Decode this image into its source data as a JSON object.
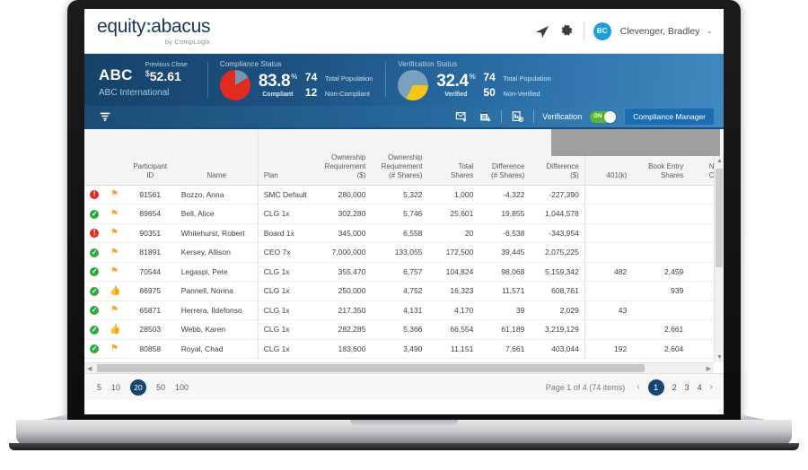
{
  "brand": {
    "logo_part1": "equity",
    "logo_sep": ":",
    "logo_part2": "abacus",
    "logo_tagline": "by CompLogix"
  },
  "topbar": {
    "send_icon": "paper-plane-icon",
    "settings_icon": "gear-icon",
    "avatar_initials": "BC",
    "user_name": "Clevenger, Bradley",
    "caret": "⌄"
  },
  "ticker": {
    "symbol": "ABC",
    "company": "ABC International",
    "prev_close_label": "Previous Close",
    "currency": "$",
    "prev_close_value": "52.61"
  },
  "compliance": {
    "title": "Compliance Status",
    "percent": "83.8",
    "percent_sup": "%",
    "percent_label": "Compliant",
    "total_population_value": "74",
    "total_population_label": "Total Population",
    "noncompliant_value": "12",
    "noncompliant_label": "Non-Compliant",
    "pie_primary_color": "#e02b20",
    "pie_secondary_color": "#7397b5"
  },
  "verification": {
    "title": "Verification Status",
    "percent": "32.4",
    "percent_sup": "%",
    "percent_label": "Verified",
    "total_population_value": "74",
    "total_population_label": "Total Population",
    "nonverified_value": "50",
    "nonverified_label": "Non-Verified",
    "pie_primary_color": "#f5c518",
    "pie_secondary_color": "#7ba0be"
  },
  "toolbar": {
    "filter_icon": "filter-funnel-icon",
    "mail_icon": "mail-add-icon",
    "export_icon": "excel-export-icon",
    "report_icon": "report-settings-icon",
    "verification_label": "Verification",
    "toggle_state": "ON",
    "compliance_manager_label": "Compliance Manager"
  },
  "grid": {
    "group_header": "",
    "columns": [
      {
        "label": "",
        "key": "status"
      },
      {
        "label": "",
        "key": "flag"
      },
      {
        "label": "Participant ID",
        "lines": [
          "Participant",
          "ID"
        ]
      },
      {
        "label": "Name",
        "lines": [
          "Name"
        ]
      },
      {
        "label": "Plan",
        "lines": [
          "Plan"
        ]
      },
      {
        "label": "Ownership Requirement ($)",
        "lines": [
          "Ownership",
          "Requirement",
          "($)"
        ]
      },
      {
        "label": "Ownership Requirement (# Shares)",
        "lines": [
          "Ownership",
          "Requirement",
          "(# Shares)"
        ]
      },
      {
        "label": "Total Shares",
        "lines": [
          "Total",
          "Shares"
        ]
      },
      {
        "label": "Difference (# Shares)",
        "lines": [
          "Difference",
          "(# Shares)"
        ]
      },
      {
        "label": "Difference ($)",
        "lines": [
          "Difference",
          "($)"
        ]
      },
      {
        "label": "401(k)",
        "lines": [
          "401(k)"
        ]
      },
      {
        "label": "Book Entry Shares",
        "lines": [
          "Book Entry",
          "Shares"
        ]
      },
      {
        "label": "No Co",
        "lines": [
          "No",
          "Co"
        ]
      }
    ],
    "rows": [
      {
        "status": "alert",
        "mark": "flag",
        "id": "91561",
        "name": "Bozzo, Anna",
        "plan": "SMC Default",
        "own_req_dollars": "280,000",
        "own_req_shares": "5,322",
        "total_shares": "1,000",
        "diff_shares": "-4,322",
        "diff_dollars": "-227,390",
        "k401": "",
        "book_entry": "",
        "no_co": ""
      },
      {
        "status": "ok",
        "mark": "flag",
        "id": "89654",
        "name": "Bell, Alice",
        "plan": "CLG 1x",
        "own_req_dollars": "302,280",
        "own_req_shares": "5,746",
        "total_shares": "25,601",
        "diff_shares": "19,855",
        "diff_dollars": "1,044,578",
        "k401": "",
        "book_entry": "",
        "no_co": ""
      },
      {
        "status": "alert",
        "mark": "flag",
        "id": "90351",
        "name": "Whitehurst, Robert",
        "plan": "Board 1x",
        "own_req_dollars": "345,000",
        "own_req_shares": "6,558",
        "total_shares": "20",
        "diff_shares": "-6,538",
        "diff_dollars": "-343,954",
        "k401": "",
        "book_entry": "",
        "no_co": ""
      },
      {
        "status": "ok",
        "mark": "flag",
        "id": "81891",
        "name": "Kersey, Allison",
        "plan": "CEO 7x",
        "own_req_dollars": "7,000,000",
        "own_req_shares": "133,055",
        "total_shares": "172,500",
        "diff_shares": "39,445",
        "diff_dollars": "2,075,225",
        "k401": "",
        "book_entry": "",
        "no_co": ""
      },
      {
        "status": "ok",
        "mark": "flag",
        "id": "70544",
        "name": "Legaspi, Pete",
        "plan": "CLG 1x",
        "own_req_dollars": "355,470",
        "own_req_shares": "6,757",
        "total_shares": "104,824",
        "diff_shares": "98,068",
        "diff_dollars": "5,159,342",
        "k401": "482",
        "book_entry": "2,459",
        "no_co": ""
      },
      {
        "status": "ok",
        "mark": "thumb",
        "id": "86975",
        "name": "Pannell, Norina",
        "plan": "CLG 1x",
        "own_req_dollars": "250,000",
        "own_req_shares": "4,752",
        "total_shares": "16,323",
        "diff_shares": "11,571",
        "diff_dollars": "608,761",
        "k401": "",
        "book_entry": "939",
        "no_co": ""
      },
      {
        "status": "ok",
        "mark": "flag",
        "id": "65871",
        "name": "Herrera, Ildefonso",
        "plan": "CLG 1x",
        "own_req_dollars": "217,350",
        "own_req_shares": "4,131",
        "total_shares": "4,170",
        "diff_shares": "39",
        "diff_dollars": "2,029",
        "k401": "43",
        "book_entry": "",
        "no_co": ""
      },
      {
        "status": "ok",
        "mark": "thumb",
        "id": "28503",
        "name": "Webb, Karen",
        "plan": "CLG 1x",
        "own_req_dollars": "282,285",
        "own_req_shares": "5,366",
        "total_shares": "66,554",
        "diff_shares": "61,189",
        "diff_dollars": "3,219,129",
        "k401": "",
        "book_entry": "2,661",
        "no_co": ""
      },
      {
        "status": "ok",
        "mark": "flag",
        "id": "80858",
        "name": "Royal, Chad",
        "plan": "CLG 1x",
        "own_req_dollars": "183,600",
        "own_req_shares": "3,490",
        "total_shares": "11,151",
        "diff_shares": "7,661",
        "diff_dollars": "403,044",
        "k401": "192",
        "book_entry": "2,604",
        "no_co": ""
      }
    ]
  },
  "footer": {
    "page_sizes": [
      "5",
      "10",
      "20",
      "50",
      "100"
    ],
    "page_size_active": "20",
    "page_info": "Page 1 of 4 (74 items)",
    "prev_arrow": "‹",
    "next_arrow": "›",
    "pages": [
      "1",
      "2",
      "3",
      "4"
    ],
    "page_active": "1"
  }
}
